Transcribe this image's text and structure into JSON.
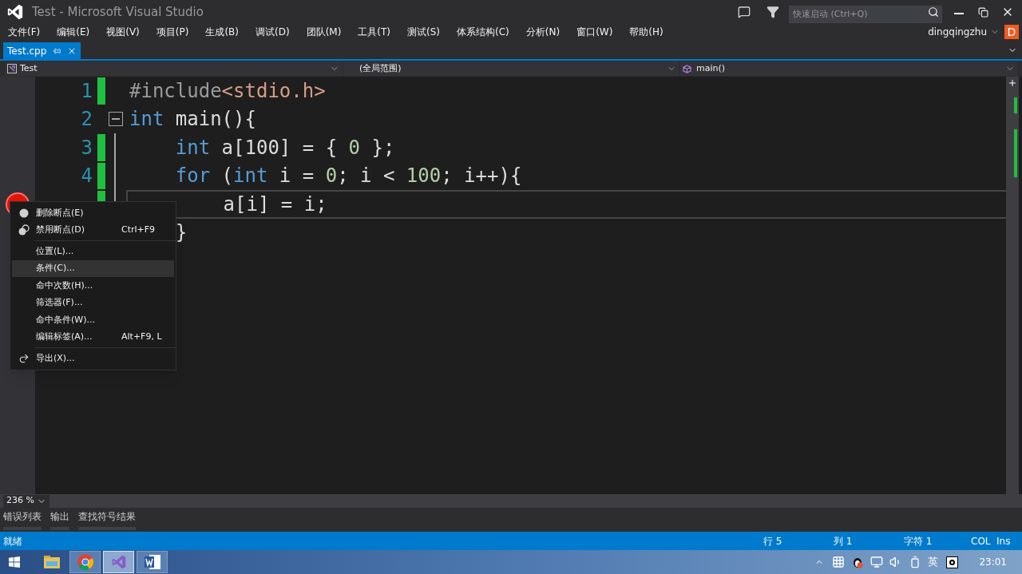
{
  "window": {
    "title": "Test - Microsoft Visual Studio"
  },
  "quick_launch": {
    "placeholder": "快速启动 (Ctrl+Q)"
  },
  "user": {
    "name": "dingqingzhu",
    "avatar": "D"
  },
  "menu_bar": [
    "文件(F)",
    "编辑(E)",
    "视图(V)",
    "项目(P)",
    "生成(B)",
    "调试(D)",
    "团队(M)",
    "工具(T)",
    "测试(S)",
    "体系结构(C)",
    "分析(N)",
    "窗口(W)",
    "帮助(H)"
  ],
  "tabs": [
    {
      "label": "Test.cpp",
      "selected": true
    }
  ],
  "navigation": {
    "project": "Test",
    "scope": "(全局范围)",
    "member": "main()"
  },
  "code_lines": [
    {
      "number": "1",
      "changed": true,
      "breakpoint": false,
      "current": false,
      "collapsible": false,
      "tokens": [
        {
          "kind": "preproc",
          "text": "#include"
        },
        {
          "kind": "string",
          "text": "<stdio.h>"
        }
      ]
    },
    {
      "number": "2",
      "changed": false,
      "breakpoint": false,
      "current": false,
      "collapsible": true,
      "tokens": [
        {
          "kind": "keyword",
          "text": "int"
        },
        {
          "kind": "plain",
          "text": " main(){"
        }
      ],
      "children": [
        {
          "number": "3",
          "changed": true,
          "breakpoint": false,
          "current": false,
          "collapsible": false,
          "tokens": [
            {
              "kind": "keyword",
              "text": "int"
            },
            {
              "kind": "plain",
              "text": " a[100] = { "
            },
            {
              "kind": "number",
              "text": "0"
            },
            {
              "kind": "plain",
              "text": " };"
            }
          ]
        },
        {
          "number": "4",
          "changed": true,
          "breakpoint": false,
          "current": false,
          "collapsible": false,
          "tokens": [
            {
              "kind": "keyword",
              "text": "for"
            },
            {
              "kind": "plain",
              "text": " ("
            },
            {
              "kind": "keyword",
              "text": "int"
            },
            {
              "kind": "plain",
              "text": " i = "
            },
            {
              "kind": "number",
              "text": "0"
            },
            {
              "kind": "plain",
              "text": "; i < "
            },
            {
              "kind": "number",
              "text": "100"
            },
            {
              "kind": "plain",
              "text": "; i++){"
            }
          ],
          "children": [
            {
              "changed": true,
              "breakpoint": true,
              "current": true,
              "collapsible": false,
              "tokens": [
                {
                  "kind": "plain",
                  "text": "a[i] = i;"
                }
              ]
            }
          ]
        },
        {
          "changed": false,
          "breakpoint": false,
          "current": false,
          "collapsible": false,
          "tokens": [
            {
              "kind": "plain",
              "text": "}"
            }
          ]
        }
      ]
    }
  ],
  "context_menu": [
    {
      "kind": "remove",
      "label": "删除断点(E)",
      "selected": false
    },
    {
      "kind": "disable",
      "label": "禁用断点(D)",
      "shortcut": "Ctrl+F9",
      "selected": false
    },
    {
      "kind": "separator"
    },
    {
      "kind": "plain",
      "label": "位置(L)...",
      "selected": false
    },
    {
      "kind": "plain",
      "label": "条件(C)...",
      "selected": true
    },
    {
      "kind": "plain",
      "label": "命中次数(H)...",
      "selected": false
    },
    {
      "kind": "plain",
      "label": "筛选器(F)...",
      "selected": false
    },
    {
      "kind": "plain",
      "label": "命中条件(W)...",
      "selected": false
    },
    {
      "kind": "plain",
      "label": "编辑标签(A)...",
      "shortcut": "Alt+F9, L",
      "selected": false
    },
    {
      "kind": "separator"
    },
    {
      "kind": "export",
      "label": "导出(X)...",
      "selected": false
    }
  ],
  "zoom": "236 %",
  "tool_tabs": [
    "错误列表",
    "输出",
    "查找符号结果"
  ],
  "status_bar": {
    "message": "就绪",
    "line": "行 5",
    "column": "列 1",
    "char": "字符 1",
    "col": "COL",
    "ins": "Ins"
  },
  "taskbar": {
    "apps": [
      {
        "kind": "explorer",
        "running": false,
        "selected": false
      },
      {
        "kind": "chrome",
        "running": true,
        "selected": false
      },
      {
        "kind": "visual-studio",
        "running": true,
        "selected": true
      },
      {
        "kind": "word",
        "running": true,
        "selected": false
      }
    ],
    "ime": "英",
    "time": "23:01"
  }
}
